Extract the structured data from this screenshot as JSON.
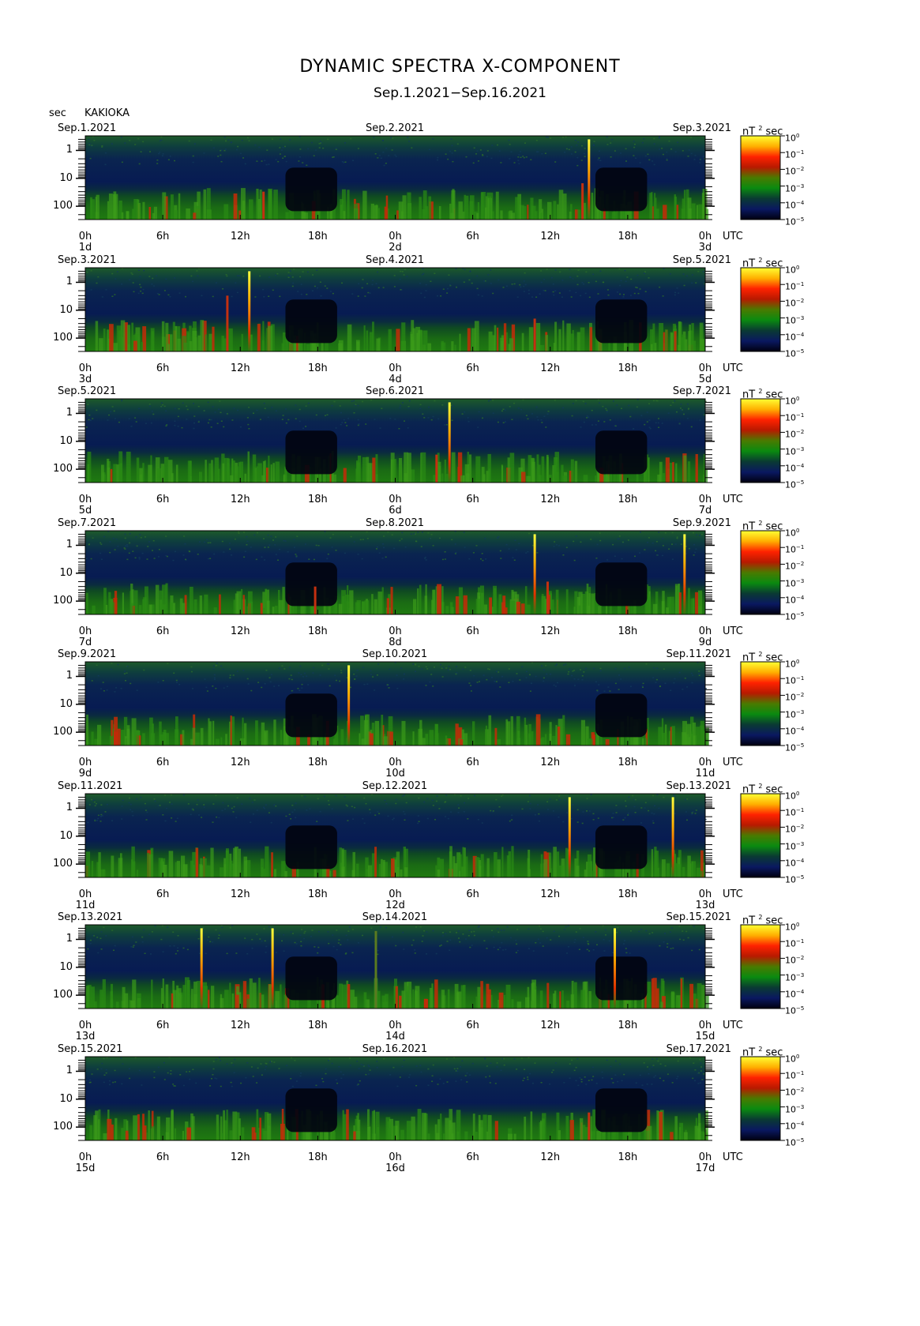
{
  "header": {
    "title": "DYNAMIC SPECTRA X-COMPONENT",
    "subtitle": "Sep.1.2021−Sep.16.2021",
    "y_unit": "sec",
    "station": "KAKIOKA"
  },
  "colorbar": {
    "unit_prefix": "nT",
    "unit_power": "2",
    "unit_suffix": "sec",
    "tick_base": "10",
    "tick_exponents": [
      "0",
      "−1",
      "−2",
      "−3",
      "−4",
      "−5"
    ],
    "colors": [
      "#ffff33",
      "#ffb000",
      "#ff2200",
      "#b81a00",
      "#4a7a00",
      "#0a8a10",
      "#0a3a33",
      "#0a1860",
      "#000010"
    ]
  },
  "x_ticks": [
    "0h",
    "6h",
    "12h",
    "18h",
    "0h",
    "6h",
    "12h",
    "18h",
    "0h"
  ],
  "x_axis_unit": "UTC",
  "y_ticks": [
    "1",
    "10",
    "100"
  ],
  "panels": [
    {
      "date_left": "Sep.1.2021",
      "date_mid": "Sep.2.2021",
      "date_right": "Sep.3.2021",
      "day_left": "1d",
      "day_mid": "2d",
      "day_right": "3d"
    },
    {
      "date_left": "Sep.3.2021",
      "date_mid": "Sep.4.2021",
      "date_right": "Sep.5.2021",
      "day_left": "3d",
      "day_mid": "4d",
      "day_right": "5d"
    },
    {
      "date_left": "Sep.5.2021",
      "date_mid": "Sep.6.2021",
      "date_right": "Sep.7.2021",
      "day_left": "5d",
      "day_mid": "6d",
      "day_right": "7d"
    },
    {
      "date_left": "Sep.7.2021",
      "date_mid": "Sep.8.2021",
      "date_right": "Sep.9.2021",
      "day_left": "7d",
      "day_mid": "8d",
      "day_right": "9d"
    },
    {
      "date_left": "Sep.9.2021",
      "date_mid": "Sep.10.2021",
      "date_right": "Sep.11.2021",
      "day_left": "9d",
      "day_mid": "10d",
      "day_right": "11d"
    },
    {
      "date_left": "Sep.11.2021",
      "date_mid": "Sep.12.2021",
      "date_right": "Sep.13.2021",
      "day_left": "11d",
      "day_mid": "12d",
      "day_right": "13d"
    },
    {
      "date_left": "Sep.13.2021",
      "date_mid": "Sep.14.2021",
      "date_right": "Sep.15.2021",
      "day_left": "13d",
      "day_mid": "14d",
      "day_right": "15d"
    },
    {
      "date_left": "Sep.15.2021",
      "date_mid": "Sep.16.2021",
      "date_right": "Sep.17.2021",
      "day_left": "15d",
      "day_mid": "16d",
      "day_right": "17d"
    }
  ],
  "chart_data": {
    "type": "heatmap",
    "title": "DYNAMIC SPECTRA X-COMPONENT",
    "x_unit": "hours UTC",
    "x_range_hours_per_panel": [
      0,
      48
    ],
    "y_axis": "period (sec)",
    "y_scale": "log",
    "y_range": [
      0.3,
      300
    ],
    "value_unit": "nT^2 sec",
    "value_range_log10": [
      -5,
      0
    ],
    "panels": [
      {
        "start": "Sep.1.2021",
        "quiet_intervals_hours": [
          [
            15.5,
            19.5
          ],
          [
            39.5,
            43.5
          ]
        ],
        "bursts": [
          {
            "hour": 39.0,
            "period_top": 0.4,
            "level": 0
          },
          {
            "hour": 38.5,
            "period_top": 15,
            "level": -2
          },
          {
            "hour": 13.8,
            "period_top": 30,
            "level": -2
          }
        ]
      },
      {
        "start": "Sep.3.2021",
        "quiet_intervals_hours": [
          [
            15.5,
            19.5
          ],
          [
            39.5,
            43.5
          ]
        ],
        "bursts": [
          {
            "hour": 12.7,
            "period_top": 0.4,
            "level": 0
          },
          {
            "hour": 11.0,
            "period_top": 3,
            "level": -2
          },
          {
            "hour": 34.8,
            "period_top": 20,
            "level": -2
          }
        ]
      },
      {
        "start": "Sep.5.2021",
        "quiet_intervals_hours": [
          [
            15.5,
            19.5
          ],
          [
            39.5,
            43.5
          ]
        ],
        "bursts": [
          {
            "hour": 28.2,
            "period_top": 0.4,
            "level": 0
          },
          {
            "hour": 27.2,
            "period_top": 30,
            "level": -2
          }
        ]
      },
      {
        "start": "Sep.7.2021",
        "quiet_intervals_hours": [
          [
            15.5,
            19.5
          ],
          [
            39.5,
            43.5
          ]
        ],
        "bursts": [
          {
            "hour": 34.8,
            "period_top": 0.4,
            "level": 0
          },
          {
            "hour": 46.4,
            "period_top": 0.4,
            "level": 0
          },
          {
            "hour": 35.8,
            "period_top": 20,
            "level": -2
          },
          {
            "hour": 17.8,
            "period_top": 30,
            "level": -2
          }
        ]
      },
      {
        "start": "Sep.9.2021",
        "quiet_intervals_hours": [
          [
            15.5,
            19.5
          ],
          [
            39.5,
            43.5
          ]
        ],
        "bursts": [
          {
            "hour": 20.4,
            "period_top": 0.4,
            "level": 0
          }
        ]
      },
      {
        "start": "Sep.11.2021",
        "quiet_intervals_hours": [
          [
            15.5,
            19.5
          ],
          [
            39.5,
            43.5
          ]
        ],
        "bursts": [
          {
            "hour": 37.5,
            "period_top": 0.4,
            "level": 0
          },
          {
            "hour": 45.5,
            "period_top": 0.4,
            "level": 0
          }
        ]
      },
      {
        "start": "Sep.13.2021",
        "quiet_intervals_hours": [
          [
            15.5,
            19.5
          ],
          [
            39.5,
            43.5
          ]
        ],
        "bursts": [
          {
            "hour": 9.0,
            "period_top": 0.4,
            "level": 0
          },
          {
            "hour": 14.5,
            "period_top": 0.4,
            "level": 0
          },
          {
            "hour": 41.0,
            "period_top": 0.4,
            "level": 0
          },
          {
            "hour": 22.5,
            "period_top": 0.5,
            "level": -3
          }
        ]
      },
      {
        "start": "Sep.15.2021",
        "quiet_intervals_hours": [
          [
            15.5,
            19.5
          ],
          [
            39.5,
            43.5
          ]
        ],
        "bursts": [
          {
            "hour": 39.0,
            "period_top": 30,
            "level": -2
          }
        ]
      }
    ]
  }
}
